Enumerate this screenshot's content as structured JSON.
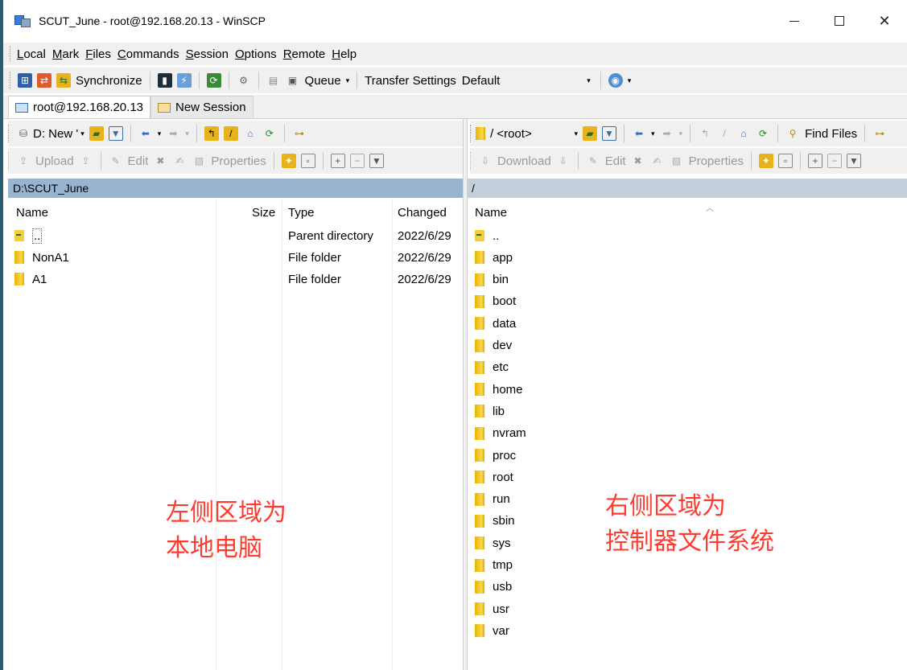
{
  "window": {
    "title": "SCUT_June - root@192.168.20.13 - WinSCP",
    "minimize": "—",
    "maximize": "☐",
    "close": "✕"
  },
  "menu": [
    "Local",
    "Mark",
    "Files",
    "Commands",
    "Session",
    "Options",
    "Remote",
    "Help"
  ],
  "toolbar": {
    "synchronize": "Synchronize",
    "queue": "Queue",
    "transfer_settings": "Transfer Settings",
    "transfer_preset": "Default"
  },
  "tabs": [
    {
      "label": "root@192.168.20.13"
    },
    {
      "label": "New Session"
    }
  ],
  "left_toolbar": {
    "drive": "D: New '",
    "upload": "Upload",
    "edit": "Edit",
    "properties": "Properties"
  },
  "right_toolbar": {
    "path": "/ <root>",
    "find_files": "Find Files",
    "download": "Download",
    "edit": "Edit",
    "properties": "Properties"
  },
  "left_pane": {
    "path": "D:\\SCUT_June",
    "columns": [
      "Name",
      "Size",
      "Type",
      "Changed"
    ],
    "rows": [
      {
        "name": "..",
        "size": "",
        "type": "Parent directory",
        "changed": "2022/6/29"
      },
      {
        "name": "NonA1",
        "size": "",
        "type": "File folder",
        "changed": "2022/6/29"
      },
      {
        "name": "A1",
        "size": "",
        "type": "File folder",
        "changed": "2022/6/29"
      }
    ],
    "annotation_line1": "左侧区域为",
    "annotation_line2": "本地电脑"
  },
  "right_pane": {
    "path": "/",
    "columns": [
      "Name"
    ],
    "rows": [
      "..",
      "app",
      "bin",
      "boot",
      "data",
      "dev",
      "etc",
      "home",
      "lib",
      "nvram",
      "proc",
      "root",
      "run",
      "sbin",
      "sys",
      "tmp",
      "usb",
      "usr",
      "var"
    ],
    "annotation_line1": "右侧区域为",
    "annotation_line2": "控制器文件系统"
  },
  "colors": {
    "left_path_bg": "#99b4d1",
    "right_path_bg": "#c4cfdc",
    "annotation": "#ff3b30",
    "folder": "#f4c21b"
  }
}
